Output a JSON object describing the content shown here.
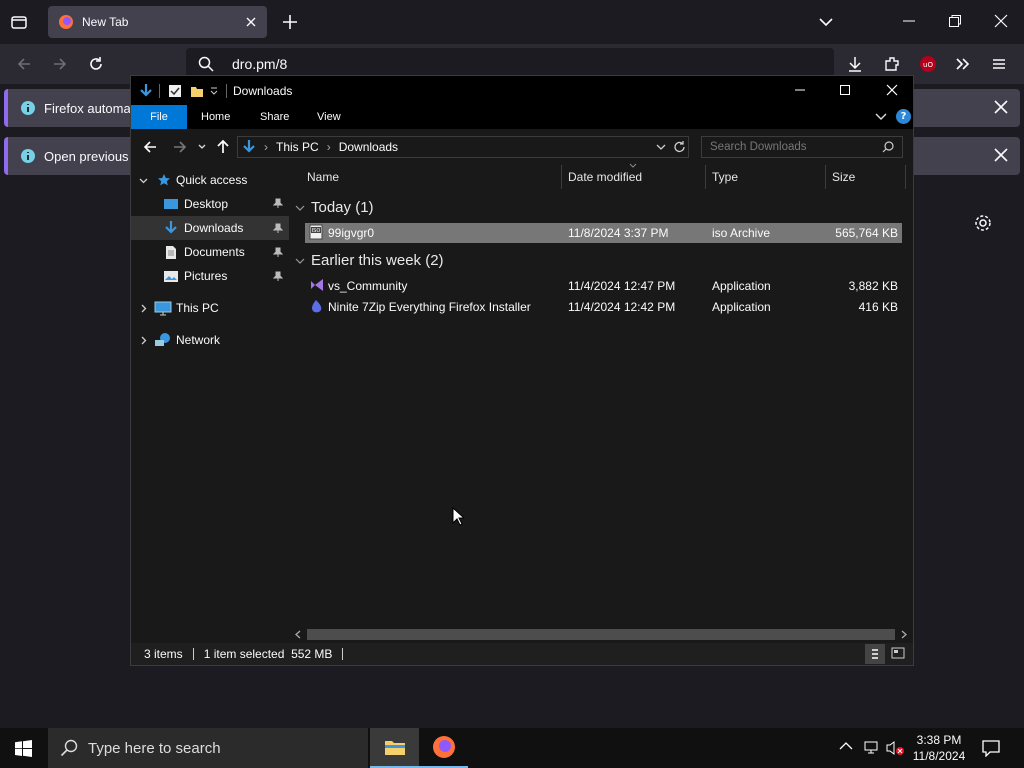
{
  "browser": {
    "tab_title": "New Tab",
    "url_text": "dro.pm/8",
    "notifications": [
      "Firefox automatio",
      "Open previous ta"
    ]
  },
  "explorer": {
    "window_title": "Downloads",
    "ribbon_tabs": [
      "File",
      "Home",
      "Share",
      "View"
    ],
    "help_label": "?",
    "breadcrumb": [
      "This PC",
      "Downloads"
    ],
    "search_placeholder": "Search Downloads",
    "nav": {
      "quick_access": "Quick access",
      "desktop": "Desktop",
      "downloads": "Downloads",
      "documents": "Documents",
      "pictures": "Pictures",
      "this_pc": "This PC",
      "network": "Network"
    },
    "columns": [
      "Name",
      "Date modified",
      "Type",
      "Size"
    ],
    "groups": [
      {
        "label": "Today (1)",
        "files": [
          {
            "name": "99igvgr0",
            "date": "11/8/2024 3:37 PM",
            "type": "iso Archive",
            "size": "565,764 KB",
            "selected": true,
            "icon": "iso-file-icon"
          }
        ]
      },
      {
        "label": "Earlier this week (2)",
        "files": [
          {
            "name": "vs_Community",
            "date": "11/4/2024 12:47 PM",
            "type": "Application",
            "size": "3,882 KB",
            "selected": false,
            "icon": "visual-studio-icon"
          },
          {
            "name": "Ninite 7Zip Everything Firefox Installer",
            "date": "11/4/2024 12:42 PM",
            "type": "Application",
            "size": "416 KB",
            "selected": false,
            "icon": "ninite-icon"
          }
        ]
      }
    ],
    "status": {
      "items": "3 items",
      "selected": "1 item selected  552 MB"
    }
  },
  "taskbar": {
    "search_placeholder": "Type here to search",
    "time": "3:38 PM",
    "date": "11/8/2024"
  },
  "colors": {
    "accent": "#0078d7",
    "selection": "#777777",
    "firefox_bg": "#1c1b22"
  }
}
